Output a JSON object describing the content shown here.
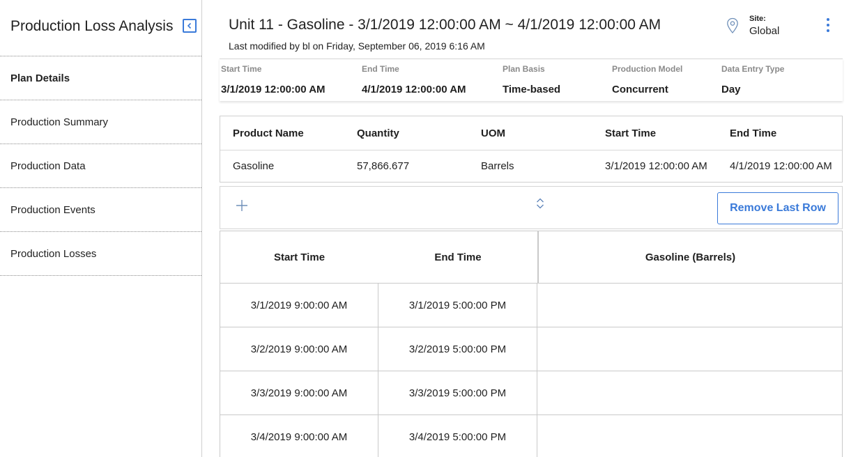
{
  "sidebar": {
    "title": "Production Loss Analysis",
    "items": [
      {
        "label": "Plan Details"
      },
      {
        "label": "Production Summary"
      },
      {
        "label": "Production Data"
      },
      {
        "label": "Production Events"
      },
      {
        "label": "Production Losses"
      }
    ],
    "active_index": 0
  },
  "header": {
    "title": "Unit 11 - Gasoline - 3/1/2019 12:00:00 AM ~ 4/1/2019 12:00:00 AM",
    "subtitle": "Last modified by bl on Friday, September 06, 2019 6:16 AM",
    "site_label": "Site:",
    "site_value": "Global"
  },
  "summary": {
    "start_time": {
      "label": "Start Time",
      "value": "3/1/2019 12:00:00 AM"
    },
    "end_time": {
      "label": "End Time",
      "value": "4/1/2019 12:00:00 AM"
    },
    "plan_basis": {
      "label": "Plan Basis",
      "value": "Time-based"
    },
    "production_model": {
      "label": "Production Model",
      "value": "Concurrent"
    },
    "data_entry_type": {
      "label": "Data Entry Type",
      "value": "Day"
    }
  },
  "product_table": {
    "headers": [
      "Product Name",
      "Quantity",
      "UOM",
      "Start Time",
      "End Time"
    ],
    "rows": [
      [
        "Gasoline",
        "57,866.677",
        "Barrels",
        "3/1/2019 12:00:00 AM",
        "4/1/2019 12:00:00 AM"
      ]
    ]
  },
  "toolbar": {
    "remove_last_row_label": "Remove Last Row"
  },
  "data_grid": {
    "headers": [
      "Start Time",
      "End Time",
      "Gasoline (Barrels)"
    ],
    "rows": [
      [
        "3/1/2019 9:00:00 AM",
        "3/1/2019 5:00:00 PM",
        ""
      ],
      [
        "3/2/2019 9:00:00 AM",
        "3/2/2019 5:00:00 PM",
        ""
      ],
      [
        "3/3/2019 9:00:00 AM",
        "3/3/2019 5:00:00 PM",
        ""
      ],
      [
        "3/4/2019 9:00:00 AM",
        "3/4/2019 5:00:00 PM",
        ""
      ]
    ]
  },
  "colors": {
    "accent": "#3a7ad9",
    "label_gray": "#8a8a8a",
    "border": "#c9c9c9"
  },
  "icons": {
    "collapse": "chevron-left-icon",
    "site": "map-pin-icon",
    "menu": "kebab-menu-icon",
    "add": "plus-icon",
    "sort": "sort-icon"
  }
}
